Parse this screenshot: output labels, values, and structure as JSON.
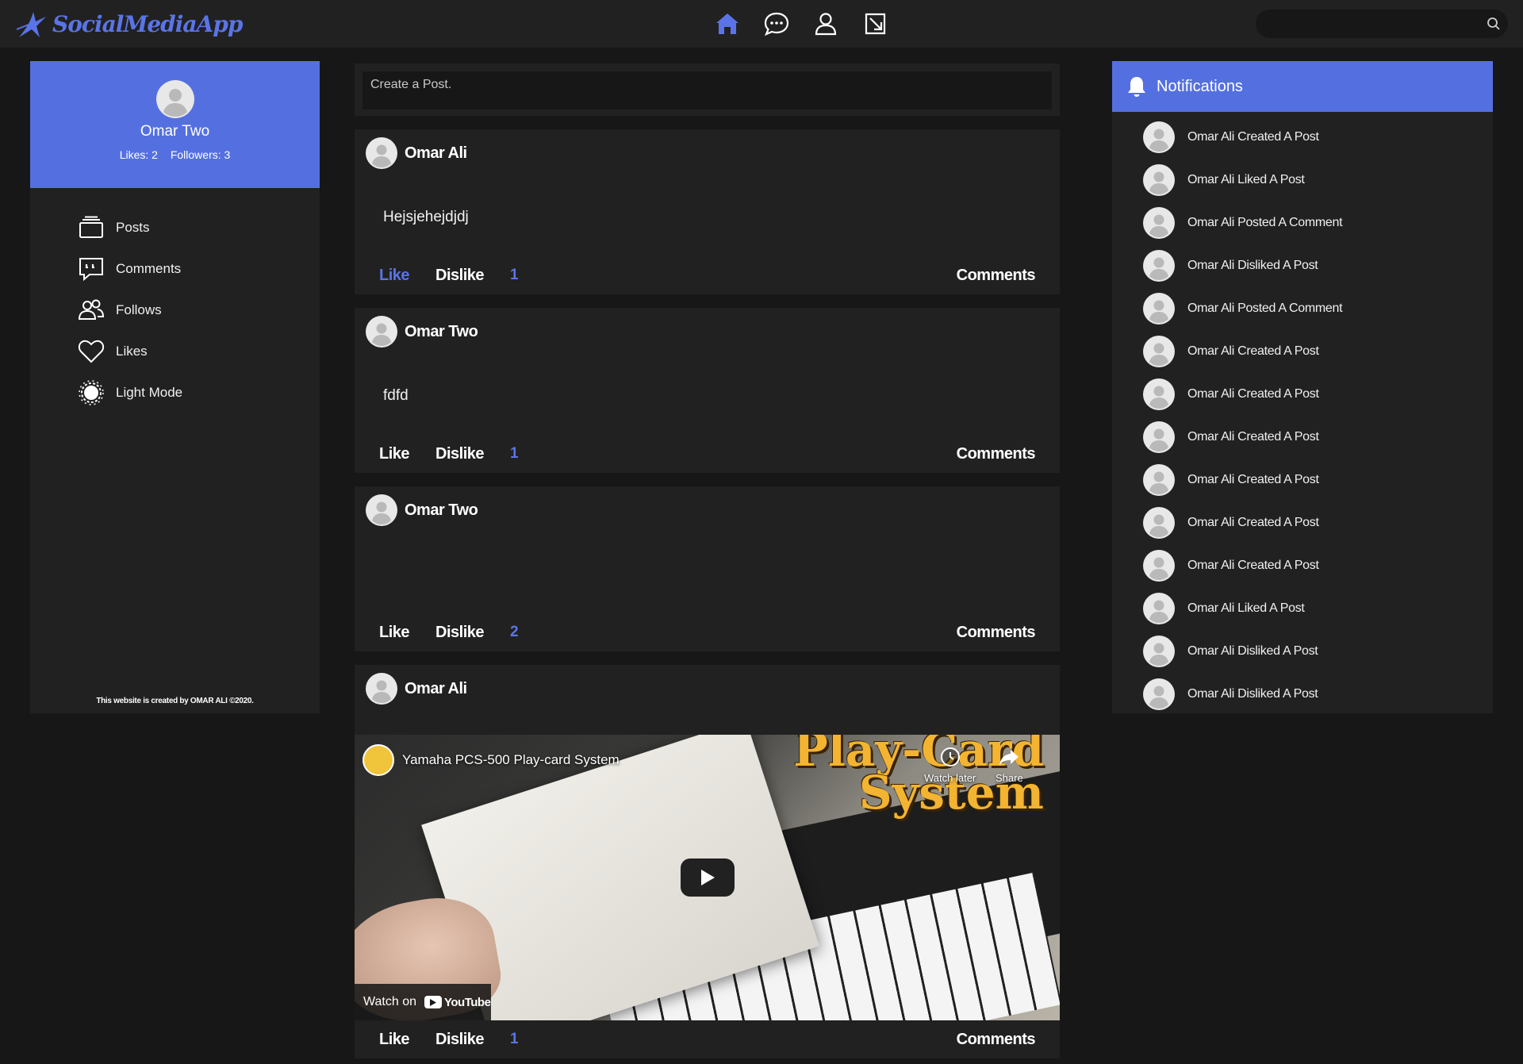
{
  "app": {
    "logo_text": "SocialMediaApp",
    "accent_color": "#5470e0"
  },
  "nav": {
    "icons": [
      "home-icon",
      "chat-icon",
      "profile-icon",
      "logout-icon"
    ]
  },
  "search": {
    "placeholder": "",
    "icon": "search-icon"
  },
  "profile": {
    "name": "Omar Two",
    "likes": "Likes: 2",
    "followers": "Followers: 3",
    "menu": [
      {
        "label": "Posts",
        "icon": "posts-icon"
      },
      {
        "label": "Comments",
        "icon": "comments-icon"
      },
      {
        "label": "Follows",
        "icon": "follows-icon"
      },
      {
        "label": "Likes",
        "icon": "heart-icon"
      },
      {
        "label": "Light Mode",
        "icon": "sun-icon"
      }
    ],
    "footer": "This website is created by OMAR ALI ©2020."
  },
  "create_post": {
    "placeholder": "Create a Post."
  },
  "posts": [
    {
      "author": "Omar Ali",
      "body": "Hejsjehejdjdj",
      "like_label": "Like",
      "like_active": true,
      "dislike_label": "Dislike",
      "count": "1",
      "comments_label": "Comments"
    },
    {
      "author": "Omar Two",
      "body": "fdfd",
      "like_label": "Like",
      "like_active": false,
      "dislike_label": "Dislike",
      "count": "1",
      "comments_label": "Comments"
    },
    {
      "author": "Omar Two",
      "body": "",
      "like_label": "Like",
      "like_active": false,
      "dislike_label": "Dislike",
      "count": "2",
      "comments_label": "Comments"
    },
    {
      "author": "Omar Ali",
      "body": "",
      "like_label": "Like",
      "like_active": false,
      "dislike_label": "Dislike",
      "count": "1",
      "comments_label": "Comments",
      "video": {
        "title": "Yamaha PCS-500 Play-card System",
        "overlay_title_line1": "Play-Card",
        "overlay_title_line2": "System",
        "watch_later": "Watch later",
        "share": "Share",
        "watch_on": "Watch on",
        "youtube": "YouTube"
      }
    }
  ],
  "notifications": {
    "title": "Notifications",
    "items": [
      "Omar Ali Created A Post",
      "Omar Ali Liked A Post",
      "Omar Ali Posted A Comment",
      "Omar Ali Disliked A Post",
      "Omar Ali Posted A Comment",
      "Omar Ali Created A Post",
      "Omar Ali Created A Post",
      "Omar Ali Created A Post",
      "Omar Ali Created A Post",
      "Omar Ali Created A Post",
      "Omar Ali Created A Post",
      "Omar Ali Liked A Post",
      "Omar Ali Disliked A Post",
      "Omar Ali Disliked A Post"
    ]
  }
}
